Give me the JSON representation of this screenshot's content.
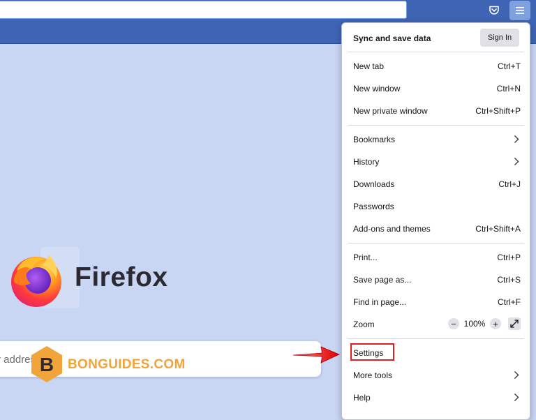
{
  "toolbar": {
    "url_value": "",
    "pocket_icon": "pocket-icon",
    "menu_icon": "hamburger-menu-icon"
  },
  "newtab": {
    "logo_text": "Firefox",
    "search_placeholder": "r address",
    "watermark_text": "BONGUIDES.COM",
    "watermark_letter": "B"
  },
  "menu": {
    "sync_label": "Sync and save data",
    "sign_in_label": "Sign In",
    "items": [
      {
        "label": "New tab",
        "shortcut": "Ctrl+T"
      },
      {
        "label": "New window",
        "shortcut": "Ctrl+N"
      },
      {
        "label": "New private window",
        "shortcut": "Ctrl+Shift+P"
      },
      {
        "label": "Bookmarks",
        "shortcut": ""
      },
      {
        "label": "History",
        "shortcut": ""
      },
      {
        "label": "Downloads",
        "shortcut": "Ctrl+J"
      },
      {
        "label": "Passwords",
        "shortcut": ""
      },
      {
        "label": "Add-ons and themes",
        "shortcut": "Ctrl+Shift+A"
      },
      {
        "label": "Print...",
        "shortcut": "Ctrl+P"
      },
      {
        "label": "Save page as...",
        "shortcut": "Ctrl+S"
      },
      {
        "label": "Find in page...",
        "shortcut": "Ctrl+F"
      },
      {
        "label": "Zoom",
        "shortcut": ""
      },
      {
        "label": "Settings",
        "shortcut": ""
      },
      {
        "label": "More tools",
        "shortcut": ""
      },
      {
        "label": "Help",
        "shortcut": ""
      }
    ],
    "zoom": {
      "minus": "−",
      "value": "100%",
      "plus": "+"
    }
  },
  "colors": {
    "toolbar": "#3f64b4",
    "page_bg": "#c9d6f3",
    "highlight": "#e02020",
    "watermark": "#f0a43a"
  }
}
